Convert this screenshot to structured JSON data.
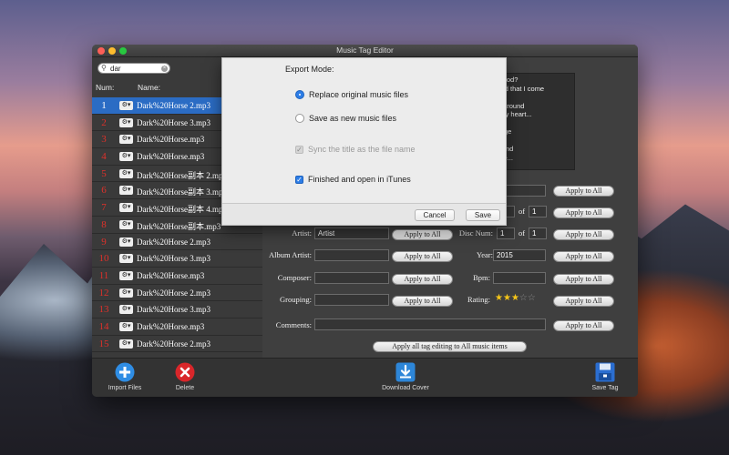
{
  "window": {
    "title": "Music Tag Editor"
  },
  "search": {
    "value": "dar"
  },
  "list": {
    "num_header": "Num:",
    "name_header": "Name:",
    "rows": [
      {
        "num": "1",
        "name": "Dark%20Horse 2.mp3"
      },
      {
        "num": "2",
        "name": "Dark%20Horse 3.mp3"
      },
      {
        "num": "3",
        "name": "Dark%20Horse.mp3"
      },
      {
        "num": "4",
        "name": "Dark%20Horse.mp3"
      },
      {
        "num": "5",
        "name": "Dark%20Horse副本 2.mp3"
      },
      {
        "num": "6",
        "name": "Dark%20Horse副本 3.mp3"
      },
      {
        "num": "7",
        "name": "Dark%20Horse副本 4.mp3"
      },
      {
        "num": "8",
        "name": "Dark%20Horse副本.mp3"
      },
      {
        "num": "9",
        "name": "Dark%20Horse 2.mp3"
      },
      {
        "num": "10",
        "name": "Dark%20Horse 3.mp3"
      },
      {
        "num": "11",
        "name": "Dark%20Horse.mp3"
      },
      {
        "num": "12",
        "name": "Dark%20Horse 2.mp3"
      },
      {
        "num": "13",
        "name": "Dark%20Horse 3.mp3"
      },
      {
        "num": "14",
        "name": "Dark%20Horse.mp3"
      },
      {
        "num": "15",
        "name": "Dark%20Horse 2.mp3"
      }
    ]
  },
  "lyrics": {
    "lines": [
      "ildhood?",
      "world that I come",
      "",
      "ing around",
      "of my heart...",
      "ne",
      "trange",
      "",
      "around",
      "n me...",
      "e"
    ]
  },
  "tags": {
    "of_label": "of",
    "track_num": "1",
    "track_total": "1",
    "artist_label": "Artist:",
    "artist_value": "Artist",
    "disc_label": "Disc Num:",
    "disc_num": "1",
    "disc_total": "1",
    "album_artist_label": "Album Artist:",
    "year_label": "Year:",
    "year_value": "2015",
    "composer_label": "Composer:",
    "bpm_label": "Bpm:",
    "grouping_label": "Grouping:",
    "rating_label": "Rating:",
    "rating_value": 3,
    "rating_max": 5,
    "comments_label": "Comments:",
    "apply_label": "Apply to All",
    "apply_all_label": "Apply all tag editing to All music items"
  },
  "toolbar": {
    "import": "Import Files",
    "delete": "Delete",
    "download": "Download Cover",
    "save": "Save Tag"
  },
  "sheet": {
    "header": "Export Mode:",
    "replace": "Replace original music files",
    "save_new": "Save as new music files",
    "sync": "Sync the title as the file name",
    "finished": "Finished and open in iTunes",
    "cancel": "Cancel",
    "save": "Save"
  },
  "colors": {
    "accent": "#2d7de6",
    "selection": "#2b6cc4",
    "number": "#e0312a",
    "star": "#f5c518"
  }
}
